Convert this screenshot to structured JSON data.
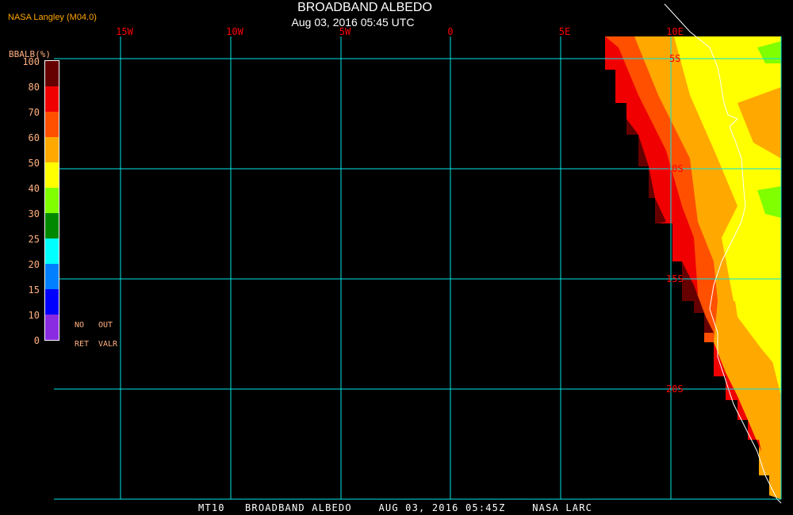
{
  "header": {
    "agency": "NASA Langley (M04.0)",
    "title": "BROADBAND ALBEDO",
    "subtitle": "Aug 03, 2016 05:45 UTC"
  },
  "map": {
    "longitude_labels": [
      "15W",
      "10W",
      "5W",
      "0",
      "5E",
      "10E"
    ],
    "latitude_labels": [
      "5S",
      "10S",
      "15S",
      "20S"
    ]
  },
  "colorbar": {
    "title": "BBALB(%)",
    "ticks": [
      "100",
      "80",
      "70",
      "60",
      "50",
      "40",
      "30",
      "25",
      "20",
      "15",
      "10",
      "0"
    ],
    "colors": [
      "#660000",
      "#f00000",
      "#ff5000",
      "#ffa800",
      "#ffff00",
      "#80ff00",
      "#008800",
      "#00ffff",
      "#0080ff",
      "#0000ff",
      "#8a2be2"
    ],
    "no_ret": [
      "NO",
      "RET"
    ],
    "out_valr": [
      "OUT",
      "VALR"
    ]
  },
  "footer": "MT10   BROADBAND ALBEDO    AUG 03, 2016 05:45Z    NASA LARC",
  "colors": {
    "grid": "#00e5e5",
    "label": "#ff0000",
    "coast": "#ffffff"
  }
}
